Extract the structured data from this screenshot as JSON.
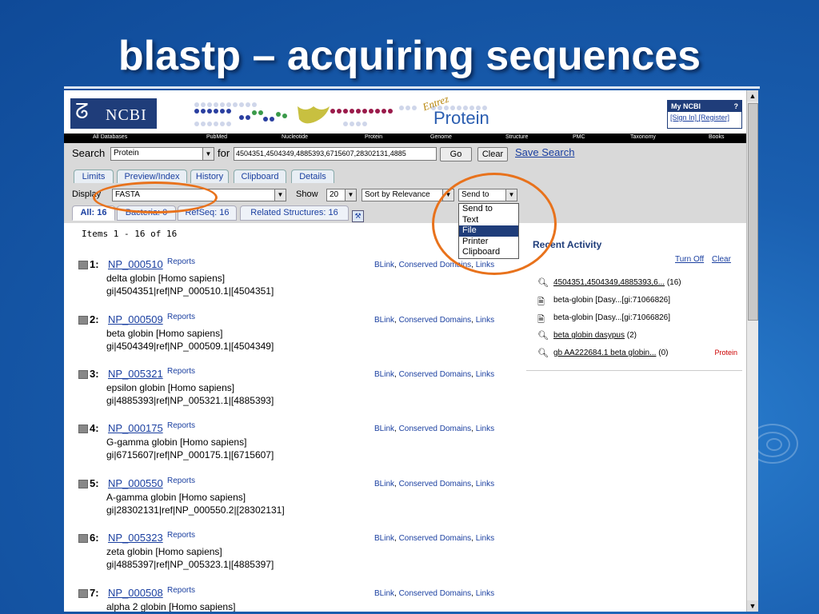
{
  "slide": {
    "title": "blastp – acquiring sequences"
  },
  "header": {
    "logo": "NCBI",
    "entrez": "Entrez",
    "product": "Protein",
    "my_ncbi": {
      "title": "My NCBI",
      "help": "?",
      "sign_in": "[Sign In]",
      "register": "[Register]"
    }
  },
  "nav": [
    "All Databases",
    "PubMed",
    "Nucleotide",
    "Protein",
    "Genome",
    "Structure",
    "PMC",
    "Taxonomy",
    "Books"
  ],
  "search": {
    "label": "Search",
    "database": "Protein",
    "for_label": "for",
    "term": "4504351,4504349,4885393,6715607,28302131,4885",
    "go": "Go",
    "clear": "Clear",
    "save": "Save Search"
  },
  "tabs": [
    "Limits",
    "Preview/Index",
    "History",
    "Clipboard",
    "Details"
  ],
  "display": {
    "label": "Display",
    "format": "FASTA",
    "show_label": "Show",
    "show_count": "20",
    "sort": "Sort by Relevance",
    "send_to": "Send to"
  },
  "send_menu": [
    "Send to",
    "Text",
    "File",
    "Printer",
    "Clipboard"
  ],
  "send_menu_selected": "File",
  "subtabs": [
    "All: 16",
    "Bacteria: 0",
    "RefSeq: 16",
    "Related Structures: 16"
  ],
  "items_count": "Items 1 - 16 of 16",
  "results": [
    {
      "num": "1:",
      "acc": "NP_000510",
      "reports": "Reports",
      "desc": "delta globin [Homo sapiens]",
      "gi": "gi|4504351|ref|NP_000510.1|[4504351]",
      "links": [
        "BLink",
        "Conserved Domains",
        "Links"
      ]
    },
    {
      "num": "2:",
      "acc": "NP_000509",
      "reports": "Reports",
      "desc": "beta globin [Homo sapiens]",
      "gi": "gi|4504349|ref|NP_000509.1|[4504349]",
      "links": [
        "BLink",
        "Conserved Domains",
        "Links"
      ]
    },
    {
      "num": "3:",
      "acc": "NP_005321",
      "reports": "Reports",
      "desc": "epsilon globin [Homo sapiens]",
      "gi": "gi|4885393|ref|NP_005321.1|[4885393]",
      "links": [
        "BLink",
        "Conserved Domains",
        "Links"
      ]
    },
    {
      "num": "4:",
      "acc": "NP_000175",
      "reports": "Reports",
      "desc": "G-gamma globin [Homo sapiens]",
      "gi": "gi|6715607|ref|NP_000175.1|[6715607]",
      "links": [
        "BLink",
        "Conserved Domains",
        "Links"
      ]
    },
    {
      "num": "5:",
      "acc": "NP_000550",
      "reports": "Reports",
      "desc": "A-gamma globin [Homo sapiens]",
      "gi": "gi|28302131|ref|NP_000550.2|[28302131]",
      "links": [
        "BLink",
        "Conserved Domains",
        "Links"
      ]
    },
    {
      "num": "6:",
      "acc": "NP_005323",
      "reports": "Reports",
      "desc": "zeta globin [Homo sapiens]",
      "gi": "gi|4885397|ref|NP_005323.1|[4885397]",
      "links": [
        "BLink",
        "Conserved Domains",
        "Links"
      ]
    },
    {
      "num": "7:",
      "acc": "NP_000508",
      "reports": "Reports",
      "desc": "alpha 2 globin [Homo sapiens]",
      "gi": "",
      "links": [
        "BLink",
        "Conserved Domains",
        "Links"
      ]
    }
  ],
  "recent": {
    "title": "Recent Activity",
    "turn_off": "Turn Off",
    "clear": "Clear",
    "items": [
      {
        "icon": "search-icon",
        "text": "4504351,4504349,4885393,6...",
        "count": "(16)",
        "db": ""
      },
      {
        "icon": "document-icon",
        "text": "beta-globin [Dasy...[gi:71066826]",
        "count": "",
        "db": ""
      },
      {
        "icon": "document-icon",
        "text": "beta-globin [Dasy...[gi:71066826]",
        "count": "",
        "db": ""
      },
      {
        "icon": "search-icon",
        "text": "beta globin dasypus",
        "count": "(2)",
        "db": ""
      },
      {
        "icon": "search-icon",
        "text": "gb AA222684.1 beta globin...",
        "count": "(0)",
        "db": "Protein"
      }
    ]
  }
}
